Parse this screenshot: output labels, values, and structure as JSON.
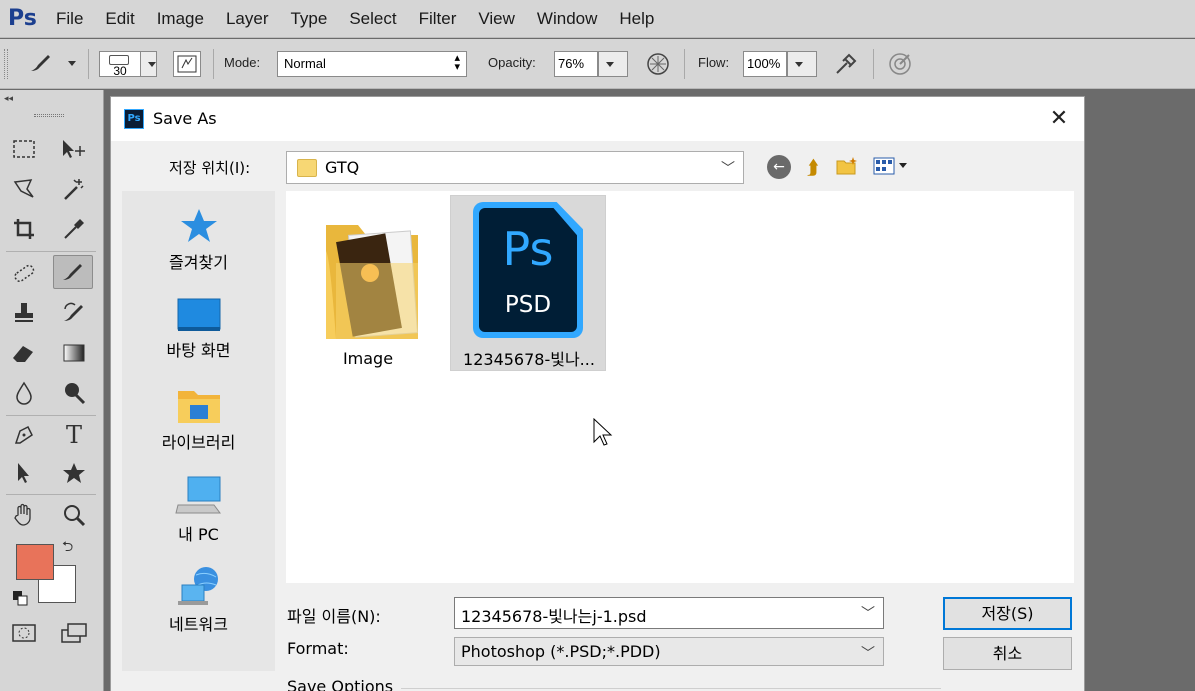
{
  "app": {
    "logo": "Ps",
    "menu": [
      "File",
      "Edit",
      "Image",
      "Layer",
      "Type",
      "Select",
      "Filter",
      "View",
      "Window",
      "Help"
    ]
  },
  "options_bar": {
    "brush_size": "30",
    "mode_label": "Mode:",
    "mode_value": "Normal",
    "opacity_label": "Opacity:",
    "opacity_value": "76%",
    "flow_label": "Flow:",
    "flow_value": "100%"
  },
  "tools_panel": {
    "foreground_color": "#e8735a",
    "background_color": "#ffffff"
  },
  "dialog": {
    "title": "Save As",
    "icon_text": "Ps",
    "look_in_label": "저장 위치(I):",
    "look_in_value": "GTQ",
    "places": [
      "즐겨찾기",
      "바탕 화면",
      "라이브러리",
      "내 PC",
      "네트워크"
    ],
    "files": [
      {
        "name": "Image",
        "type": "folder",
        "selected": false
      },
      {
        "name": "12345678-빛나...",
        "type": "psd",
        "badge_top": "Ps",
        "badge_bottom": "PSD",
        "selected": true
      }
    ],
    "file_name_label": "파일 이름(N):",
    "file_name_value": "12345678-빛나는j-1.psd",
    "format_label": "Format:",
    "format_value": "Photoshop (*.PSD;*.PDD)",
    "save_button": "저장(S)",
    "cancel_button": "취소",
    "save_options_label": "Save Options"
  }
}
